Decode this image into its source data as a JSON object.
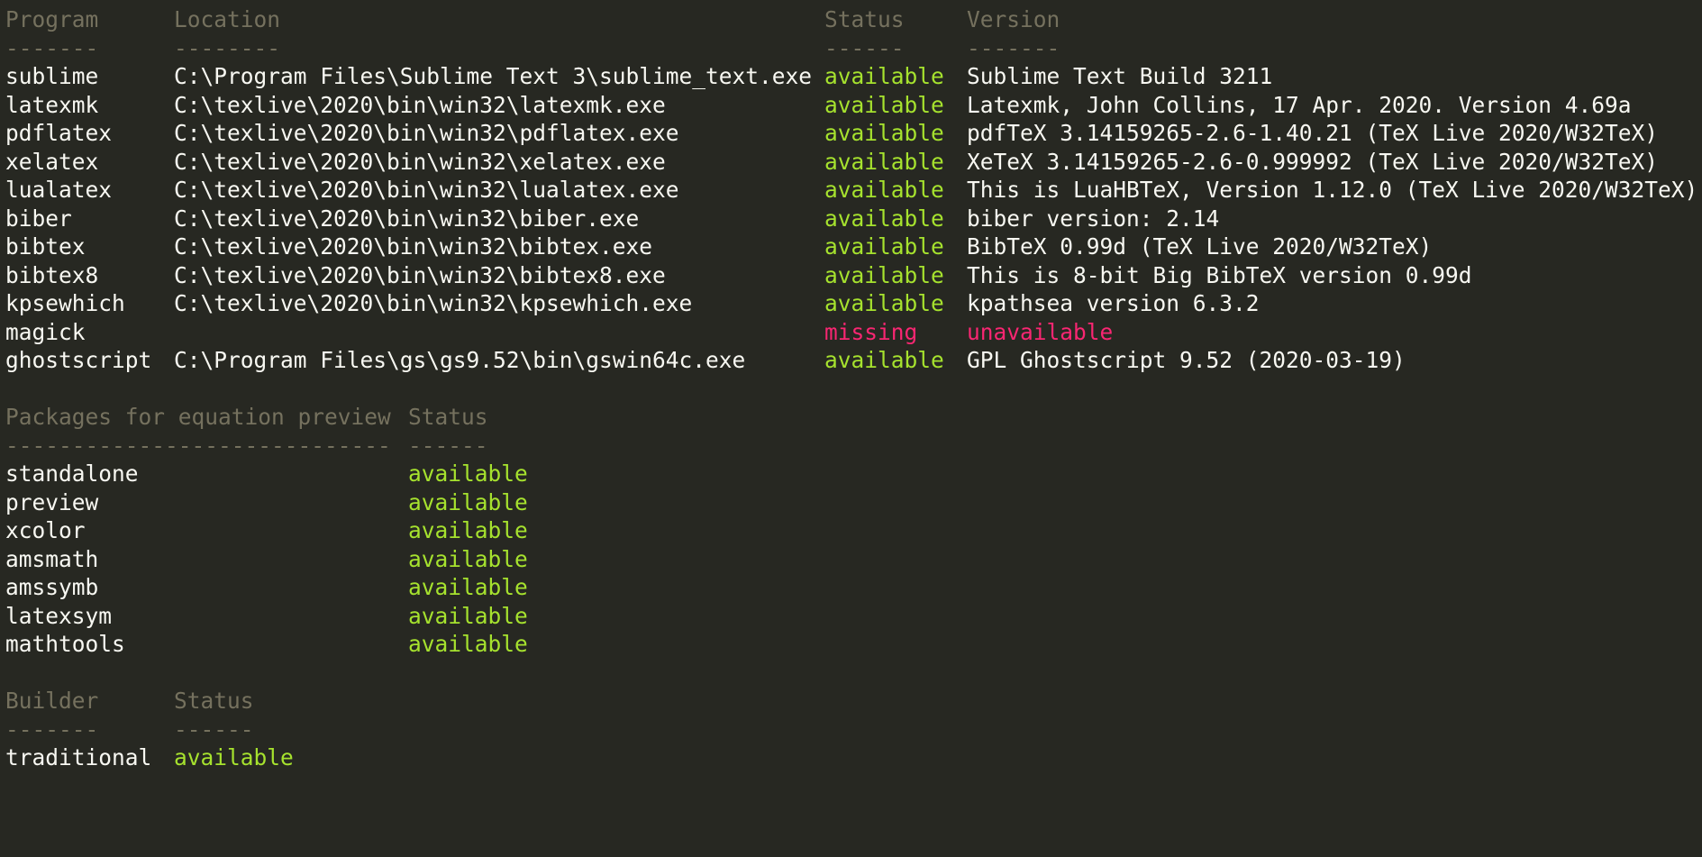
{
  "colors": {
    "background": "#272822",
    "text": "#f8f8f2",
    "header": "#75715e",
    "available": "#a6e22e",
    "missing": "#f92672"
  },
  "programs": {
    "headers": [
      "Program",
      "Location",
      "Status",
      "Version"
    ],
    "dashes": [
      "-------",
      "--------",
      "------",
      "-------"
    ],
    "rows": [
      {
        "program": "sublime",
        "location": "C:\\Program Files\\Sublime Text 3\\sublime_text.exe",
        "status": "available",
        "version": "Sublime Text Build 3211"
      },
      {
        "program": "latexmk",
        "location": "C:\\texlive\\2020\\bin\\win32\\latexmk.exe",
        "status": "available",
        "version": "Latexmk, John Collins, 17 Apr. 2020. Version 4.69a"
      },
      {
        "program": "pdflatex",
        "location": "C:\\texlive\\2020\\bin\\win32\\pdflatex.exe",
        "status": "available",
        "version": "pdfTeX 3.14159265-2.6-1.40.21 (TeX Live 2020/W32TeX)"
      },
      {
        "program": "xelatex",
        "location": "C:\\texlive\\2020\\bin\\win32\\xelatex.exe",
        "status": "available",
        "version": "XeTeX 3.14159265-2.6-0.999992 (TeX Live 2020/W32TeX)"
      },
      {
        "program": "lualatex",
        "location": "C:\\texlive\\2020\\bin\\win32\\lualatex.exe",
        "status": "available",
        "version": "This is LuaHBTeX, Version 1.12.0 (TeX Live 2020/W32TeX)"
      },
      {
        "program": "biber",
        "location": "C:\\texlive\\2020\\bin\\win32\\biber.exe",
        "status": "available",
        "version": "biber version: 2.14"
      },
      {
        "program": "bibtex",
        "location": "C:\\texlive\\2020\\bin\\win32\\bibtex.exe",
        "status": "available",
        "version": "BibTeX 0.99d (TeX Live 2020/W32TeX)"
      },
      {
        "program": "bibtex8",
        "location": "C:\\texlive\\2020\\bin\\win32\\bibtex8.exe",
        "status": "available",
        "version": "This is 8-bit Big BibTeX version 0.99d"
      },
      {
        "program": "kpsewhich",
        "location": "C:\\texlive\\2020\\bin\\win32\\kpsewhich.exe",
        "status": "available",
        "version": "kpathsea version 6.3.2"
      },
      {
        "program": "magick",
        "location": "",
        "status": "missing",
        "version": "unavailable"
      },
      {
        "program": "ghostscript",
        "location": "C:\\Program Files\\gs\\gs9.52\\bin\\gswin64c.exe",
        "status": "available",
        "version": "GPL Ghostscript 9.52 (2020-03-19)"
      }
    ]
  },
  "packages": {
    "headers": [
      "Packages for equation preview",
      "Status"
    ],
    "dashes": [
      "-----------------------------",
      "------"
    ],
    "rows": [
      {
        "name": "standalone",
        "status": "available"
      },
      {
        "name": "preview",
        "status": "available"
      },
      {
        "name": "xcolor",
        "status": "available"
      },
      {
        "name": "amsmath",
        "status": "available"
      },
      {
        "name": "amssymb",
        "status": "available"
      },
      {
        "name": "latexsym",
        "status": "available"
      },
      {
        "name": "mathtools",
        "status": "available"
      }
    ]
  },
  "builders": {
    "headers": [
      "Builder",
      "Status"
    ],
    "dashes": [
      "-------",
      "------"
    ],
    "rows": [
      {
        "name": "traditional",
        "status": "available"
      }
    ]
  }
}
